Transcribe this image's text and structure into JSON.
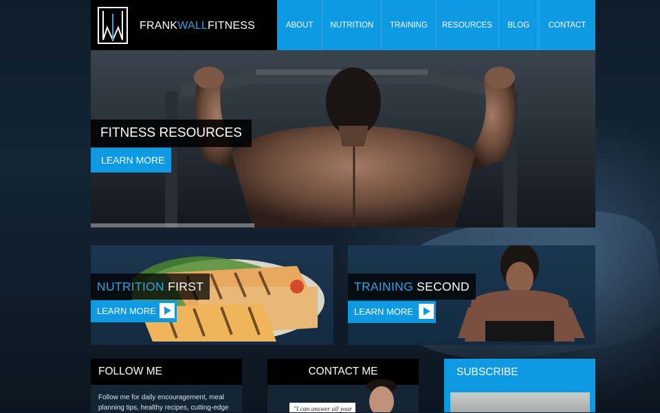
{
  "brand": {
    "logo_mark": "FW",
    "name_part1": "FRANK",
    "name_part2": "WALL",
    "name_part3": "FITNESS"
  },
  "nav": {
    "items": [
      "ABOUT",
      "NUTRITION",
      "TRAINING",
      "RESOURCES",
      "BLOG",
      "CONTACT"
    ]
  },
  "hero": {
    "title": "FITNESS RESOURCES",
    "button": "LEARN MORE"
  },
  "promos": {
    "nutrition": {
      "accent": "NUTRITION",
      "rest": " FIRST",
      "button": "LEARN MORE"
    },
    "training": {
      "accent": "TRAINING",
      "rest": " SECOND",
      "button": "LEARN MORE"
    }
  },
  "follow": {
    "title": "FOLLOW ME",
    "text": "Follow me for daily encouragement, meal planning tips, healthy recipes, cutting-edge"
  },
  "contact": {
    "title": "CONTACT ME",
    "quote": "\"I can answer all your"
  },
  "subscribe": {
    "title": "SUBSCRIBE"
  },
  "colors": {
    "accent": "#0e9ae2",
    "brand_blue": "#2ea3e0",
    "header_bg": "#000000"
  }
}
